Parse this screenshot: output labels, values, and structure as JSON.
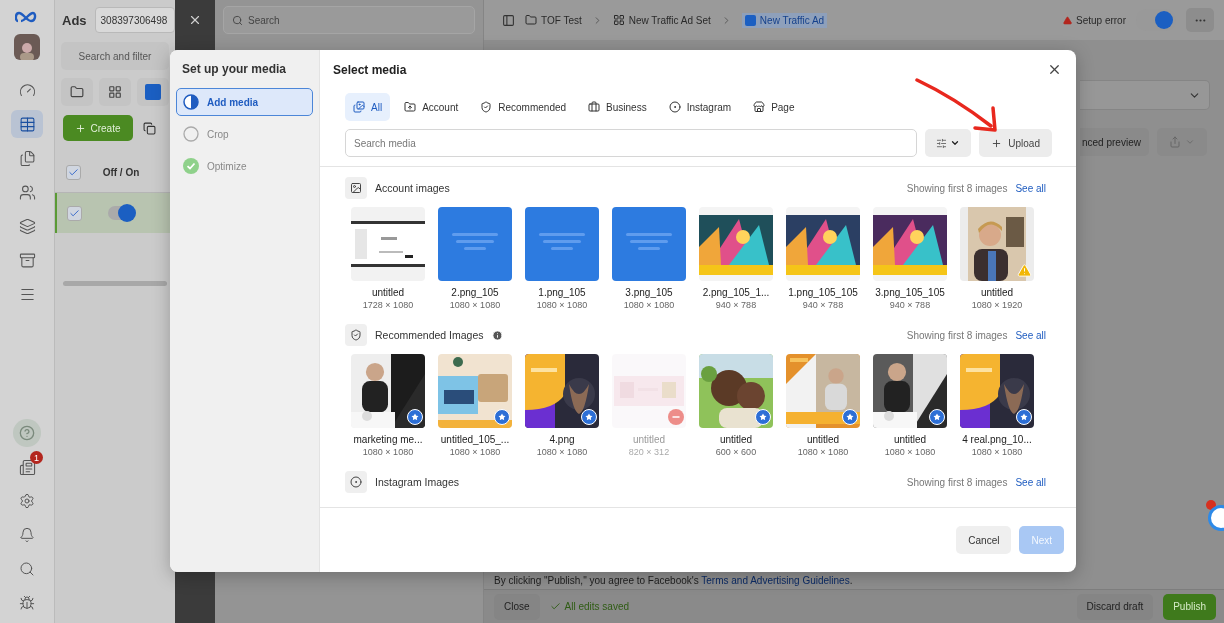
{
  "nav": {
    "items": [
      {
        "selected": false
      },
      {
        "selected": true
      },
      {
        "selected": false
      },
      {
        "selected": false
      },
      {
        "selected": false
      },
      {
        "selected": false
      },
      {
        "selected": false
      }
    ],
    "notification_count": "1"
  },
  "ads_panel": {
    "title": "Ads",
    "account_id": "308397306498",
    "search_placeholder": "Search and filter",
    "create_label": "Create",
    "column": "Off / On",
    "header_checked": true,
    "row": {
      "checked": true,
      "on": true
    }
  },
  "top_search": {
    "placeholder": "Search"
  },
  "breadcrumb": [
    {
      "label": "TOF Test",
      "kind": "folder",
      "selected": false
    },
    {
      "label": "New Traffic Ad Set",
      "kind": "grid",
      "selected": false
    },
    {
      "label": "New Traffic Ad",
      "kind": "ad",
      "selected": true
    }
  ],
  "status": {
    "label": "Setup error",
    "on": true
  },
  "preview_button": "nced preview",
  "footer": {
    "notice": "By clicking \"Publish,\" you agree to Facebook's ",
    "notice_link": "Terms and Advertising Guidelines",
    "notice_end": ".",
    "close": "Close",
    "saved": "All edits saved",
    "discard": "Discard draft",
    "publish": "Publish"
  },
  "modal": {
    "sidebar_title": "Set up your media",
    "steps": [
      {
        "label": "Add media",
        "kind": "current",
        "selected": true
      },
      {
        "label": "Crop",
        "kind": "pending",
        "selected": false
      },
      {
        "label": "Optimize",
        "kind": "done",
        "selected": false
      }
    ],
    "title": "Select media",
    "tabs": [
      {
        "label": "All",
        "selected": true
      },
      {
        "label": "Account",
        "selected": false
      },
      {
        "label": "Recommended",
        "selected": false
      },
      {
        "label": "Business",
        "selected": false
      },
      {
        "label": "Instagram",
        "selected": false
      },
      {
        "label": "Page",
        "selected": false
      }
    ],
    "search_placeholder": "Search media",
    "upload_label": "Upload",
    "sections": [
      {
        "title": "Account images",
        "info": false,
        "summary": "Showing first 8 images",
        "link": "See all",
        "items": [
          {
            "name": "untitled",
            "size": "1728 × 1080",
            "starred": false,
            "warning": false,
            "disabled": false
          },
          {
            "name": "2.png_105",
            "size": "1080 × 1080",
            "starred": false,
            "warning": false,
            "disabled": false
          },
          {
            "name": "1.png_105",
            "size": "1080 × 1080",
            "starred": false,
            "warning": false,
            "disabled": false
          },
          {
            "name": "3.png_105",
            "size": "1080 × 1080",
            "starred": false,
            "warning": false,
            "disabled": false
          },
          {
            "name": "2.png_105_1...",
            "size": "940 × 788",
            "starred": false,
            "warning": false,
            "disabled": false
          },
          {
            "name": "1.png_105_105",
            "size": "940 × 788",
            "starred": false,
            "warning": false,
            "disabled": false
          },
          {
            "name": "3.png_105_105",
            "size": "940 × 788",
            "starred": false,
            "warning": false,
            "disabled": false
          },
          {
            "name": "untitled",
            "size": "1080 × 1920",
            "starred": false,
            "warning": true,
            "disabled": false
          }
        ]
      },
      {
        "title": "Recommended Images",
        "info": true,
        "summary": "Showing first 8 images",
        "link": "See all",
        "items": [
          {
            "name": "marketing me...",
            "size": "1080 × 1080",
            "starred": true,
            "warning": false,
            "disabled": false
          },
          {
            "name": "untitled_105_...",
            "size": "1080 × 1080",
            "starred": true,
            "warning": false,
            "disabled": false
          },
          {
            "name": "4.png",
            "size": "1080 × 1080",
            "starred": true,
            "warning": false,
            "disabled": false
          },
          {
            "name": "untitled",
            "size": "820 × 312",
            "starred": false,
            "warning": false,
            "disabled": true
          },
          {
            "name": "untitled",
            "size": "600 × 600",
            "starred": true,
            "warning": false,
            "disabled": false
          },
          {
            "name": "untitled",
            "size": "1080 × 1080",
            "starred": true,
            "warning": false,
            "disabled": false
          },
          {
            "name": "untitled",
            "size": "1080 × 1080",
            "starred": true,
            "warning": false,
            "disabled": false
          },
          {
            "name": "4 real.png_10...",
            "size": "1080 × 1080",
            "starred": true,
            "warning": false,
            "disabled": false
          }
        ]
      },
      {
        "title": "Instagram Images",
        "info": false,
        "summary": "Showing first 8 images",
        "link": "See all"
      }
    ],
    "cancel": "Cancel",
    "next": {
      "label": "Next",
      "disabled": true
    }
  }
}
